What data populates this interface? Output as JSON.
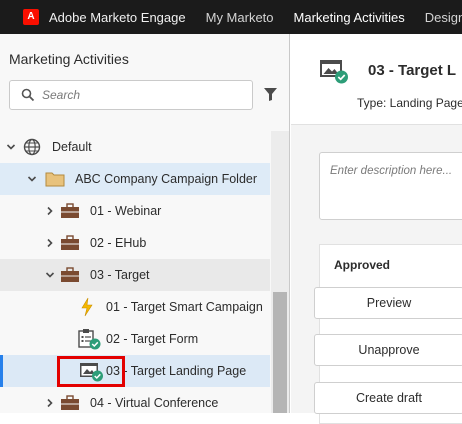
{
  "topnav": {
    "brand": "Adobe Marketo Engage",
    "brand_logo_letter": "A",
    "tabs": [
      {
        "label": "My Marketo"
      },
      {
        "label": "Marketing Activities"
      },
      {
        "label": "Design Stu"
      }
    ]
  },
  "left": {
    "title": "Marketing Activities",
    "search_placeholder": "Search",
    "tree": [
      {
        "label": "Default",
        "icon": "globe-icon"
      },
      {
        "label": "ABC Company Campaign Folder",
        "icon": "folder-icon"
      },
      {
        "label": "01 - Webinar",
        "icon": "program-briefcase-icon"
      },
      {
        "label": "02 - EHub",
        "icon": "program-briefcase-icon"
      },
      {
        "label": "03 - Target",
        "icon": "program-briefcase-icon"
      },
      {
        "label": "01 - Target Smart Campaign",
        "icon": "smart-campaign-lightning-icon"
      },
      {
        "label": "02 - Target Form",
        "icon": "form-approved-icon"
      },
      {
        "label": "03 - Target Landing Page",
        "icon": "landing-page-approved-icon"
      },
      {
        "label": "04 - Virtual Conference",
        "icon": "program-briefcase-icon"
      }
    ]
  },
  "right": {
    "title": "03 - Target L",
    "type_text": "Type: Landing Page",
    "description_placeholder": "Enter description here...",
    "status": "Approved",
    "buttons": [
      {
        "label": "Preview"
      },
      {
        "label": "Unapprove"
      },
      {
        "label": "Create draft"
      }
    ]
  },
  "colors": {
    "accent": "#2680eb",
    "highlight_box": "#e30000",
    "approved_check": "#2d9d78",
    "folder": "#e8c27c",
    "briefcase": "#7a4a30",
    "lightning": "#f5b800"
  }
}
